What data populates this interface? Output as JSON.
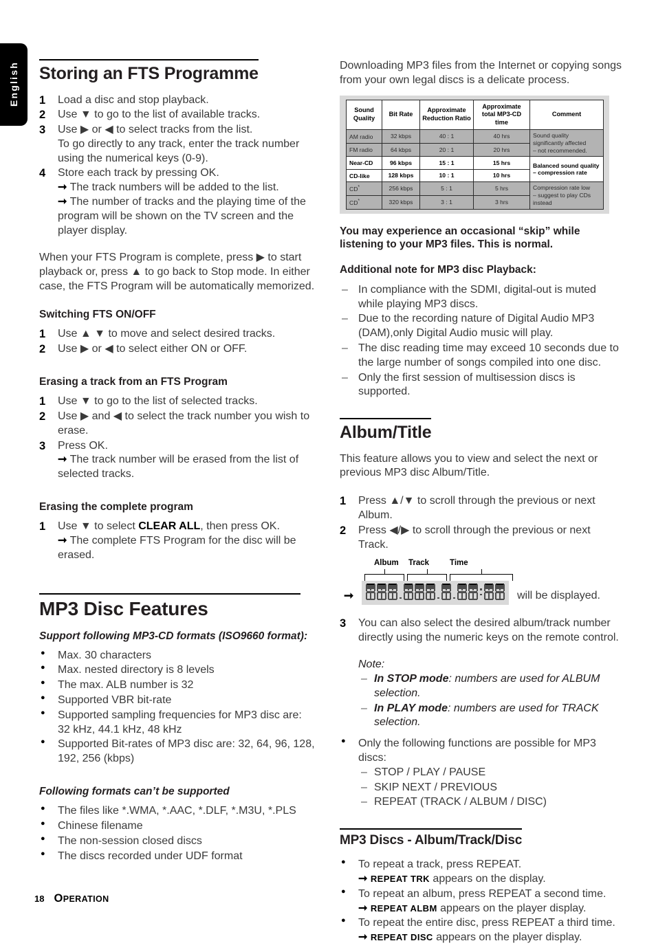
{
  "language_tab": "English",
  "footer": {
    "page_number": "18",
    "section_initial": "O",
    "section_rest": "peration"
  },
  "left_column": {
    "fts_heading": "Storing an FTS Programme",
    "fts_steps": [
      {
        "num": "1",
        "text": "Load a disc and stop playback."
      },
      {
        "num": "2",
        "text": "Use ▼ to go to the list of available tracks."
      },
      {
        "num": "3",
        "text": "Use ▶ or ◀ to select tracks from the list.",
        "cont": "To go directly to any track, enter the track number using the numerical keys (0-9)."
      },
      {
        "num": "4",
        "text": "Store each track by pressing OK.",
        "arrow1": "The track numbers will be added to the list.",
        "arrow2": "The number of tracks and the playing time of the program will be shown on the TV screen and the player display."
      }
    ],
    "fts_paragraph": "When your FTS Program is complete, press ▶ to start playback or, press ▲ to go back to Stop mode. In either case, the FTS Program will be automatically memorized.",
    "switching_heading": "Switching FTS ON/OFF",
    "switching_steps": [
      {
        "num": "1",
        "text": "Use ▲ ▼ to move and select desired tracks."
      },
      {
        "num": "2",
        "text": "Use ▶ or ◀ to select either ON or OFF."
      }
    ],
    "erasing_track_heading": "Erasing a track from an FTS Program",
    "erasing_track_steps": [
      {
        "num": "1",
        "text": "Use ▼ to go to the list of selected tracks."
      },
      {
        "num": "2",
        "text": "Use ▶ and ◀ to select the track number you wish to erase."
      },
      {
        "num": "3",
        "text": "Press OK.",
        "arrow1": "The track number will be erased from the list of selected tracks."
      }
    ],
    "erasing_program_heading": "Erasing the complete program",
    "erasing_program_steps": [
      {
        "num": "1",
        "pre": "Use ▼ to select ",
        "bold": "CLEAR ALL",
        "post": ", then press OK.",
        "arrow1": "The complete FTS Program for the disc will be erased."
      }
    ],
    "mp3_heading": "MP3 Disc Features",
    "support_heading": "Support following MP3-CD formats (ISO9660 format):",
    "support_bullets": [
      "Max. 30 characters",
      "Max. nested directory is 8 levels",
      "The max. ALB number is 32",
      "Supported VBR bit-rate",
      "Supported sampling frequencies for MP3 disc are: 32 kHz, 44.1 kHz, 48 kHz",
      "Supported Bit-rates of MP3 disc are: 32, 64, 96, 128, 192, 256 (kbps)"
    ],
    "unsupported_heading": "Following formats can’t be supported",
    "unsupported_bullets": [
      "The files like *.WMA, *.AAC, *.DLF, *.M3U, *.PLS",
      "Chinese filename",
      "The non-session closed discs",
      "The discs recorded under UDF format"
    ]
  },
  "right_column": {
    "intro_paragraph": "Downloading MP3 files from the Internet or copying songs from your own legal discs is a delicate process.",
    "table": {
      "headers": [
        "Sound Quality",
        "Bit Rate",
        "Approximate Reduction Ratio",
        "Approximate total MP3-CD time",
        "Comment"
      ],
      "rows": [
        {
          "style": "gray",
          "quality": "AM radio",
          "quality_sup": "",
          "bitrate": "32 kbps",
          "ratio": "40 : 1",
          "time": "40 hrs"
        },
        {
          "style": "gray",
          "quality": "FM radio",
          "quality_sup": "",
          "bitrate": "64 kbps",
          "ratio": "20 : 1",
          "time": "20 hrs"
        },
        {
          "style": "white",
          "quality": "Near-CD",
          "quality_sup": "",
          "bitrate": "96 kbps",
          "ratio": "15 : 1",
          "time": "15 hrs"
        },
        {
          "style": "white",
          "quality": "CD-like",
          "quality_sup": "",
          "bitrate": "128 kbps",
          "ratio": "10 : 1",
          "time": "10 hrs"
        },
        {
          "style": "gray",
          "quality": "CD",
          "quality_sup": "*",
          "bitrate": "256 kbps",
          "ratio": "5 : 1",
          "time": "5 hrs"
        },
        {
          "style": "gray",
          "quality": "CD",
          "quality_sup": "*",
          "bitrate": "320 kbps",
          "ratio": "3 : 1",
          "time": "3 hrs"
        }
      ],
      "comments": [
        {
          "style": "gray",
          "line1": "Sound quality significantly affected",
          "line2": "– not recommended.",
          "span": 2
        },
        {
          "style": "white",
          "line1": "Balanced sound quality",
          "line2": "– compression rate",
          "span": 2
        },
        {
          "style": "gray",
          "line1": "Compression rate low",
          "line2": "– suggest to play CDs instead",
          "span": 2
        }
      ]
    },
    "skip_notice": "You may experience an occasional “skip” while listening to your MP3 files. This is normal.",
    "additional_note_heading": "Additional note for MP3 disc Playback:",
    "additional_notes": [
      "In compliance with the SDMI, digital-out is muted while playing MP3 discs.",
      "Due to the recording nature of Digital Audio MP3 (DAM),only Digital Audio music will play.",
      "The disc reading time may exceed 10 seconds due to the large number of songs compiled into one disc.",
      "Only the first session of multisession discs is supported."
    ],
    "album_title_heading": "Album/Title",
    "album_title_paragraph": "This feature allows you to view and select the next or previous MP3 disc Album/Title.",
    "album_steps": [
      {
        "num": "1",
        "text": "Press ▲/▼ to scroll through the previous or next Album."
      },
      {
        "num": "2",
        "text": "Press ◀/▶ to scroll through the previous or next Track."
      }
    ],
    "display_graphic": {
      "label_album": "Album",
      "label_track": "Track",
      "label_time": "Time",
      "album_digits": 3,
      "track_digits": 3,
      "time_digits": 5,
      "caption": "will be displayed."
    },
    "step3": {
      "num": "3",
      "text": "You can also select the desired album/track number directly using the numeric keys on the remote control."
    },
    "note_label": "Note:",
    "note_items": [
      {
        "bold": "In STOP mode",
        "rest": ": numbers are used for ALBUM selection."
      },
      {
        "bold": "In PLAY mode",
        "rest": ": numbers are used for TRACK selection."
      }
    ],
    "functions_bullet": "Only the following functions are possible for MP3 discs:",
    "functions_list": [
      "STOP / PLAY / PAUSE",
      "SKIP NEXT / PREVIOUS",
      "REPEAT (TRACK / ALBUM / DISC)"
    ],
    "mp3_discs_heading": "MP3 Discs - Album/Track/Disc",
    "repeat_items": [
      {
        "text": "To repeat a track, press REPEAT.",
        "code": "REPEAT TRK",
        "after": "appears on the display."
      },
      {
        "text": "To repeat an album, press REPEAT a second time.",
        "code": "REPEAT ALBM",
        "after": "appears on the player display."
      },
      {
        "text": "To repeat the entire disc, press REPEAT a third time.",
        "code": "REPEAT DISC",
        "after": "appears on the player display."
      }
    ]
  }
}
